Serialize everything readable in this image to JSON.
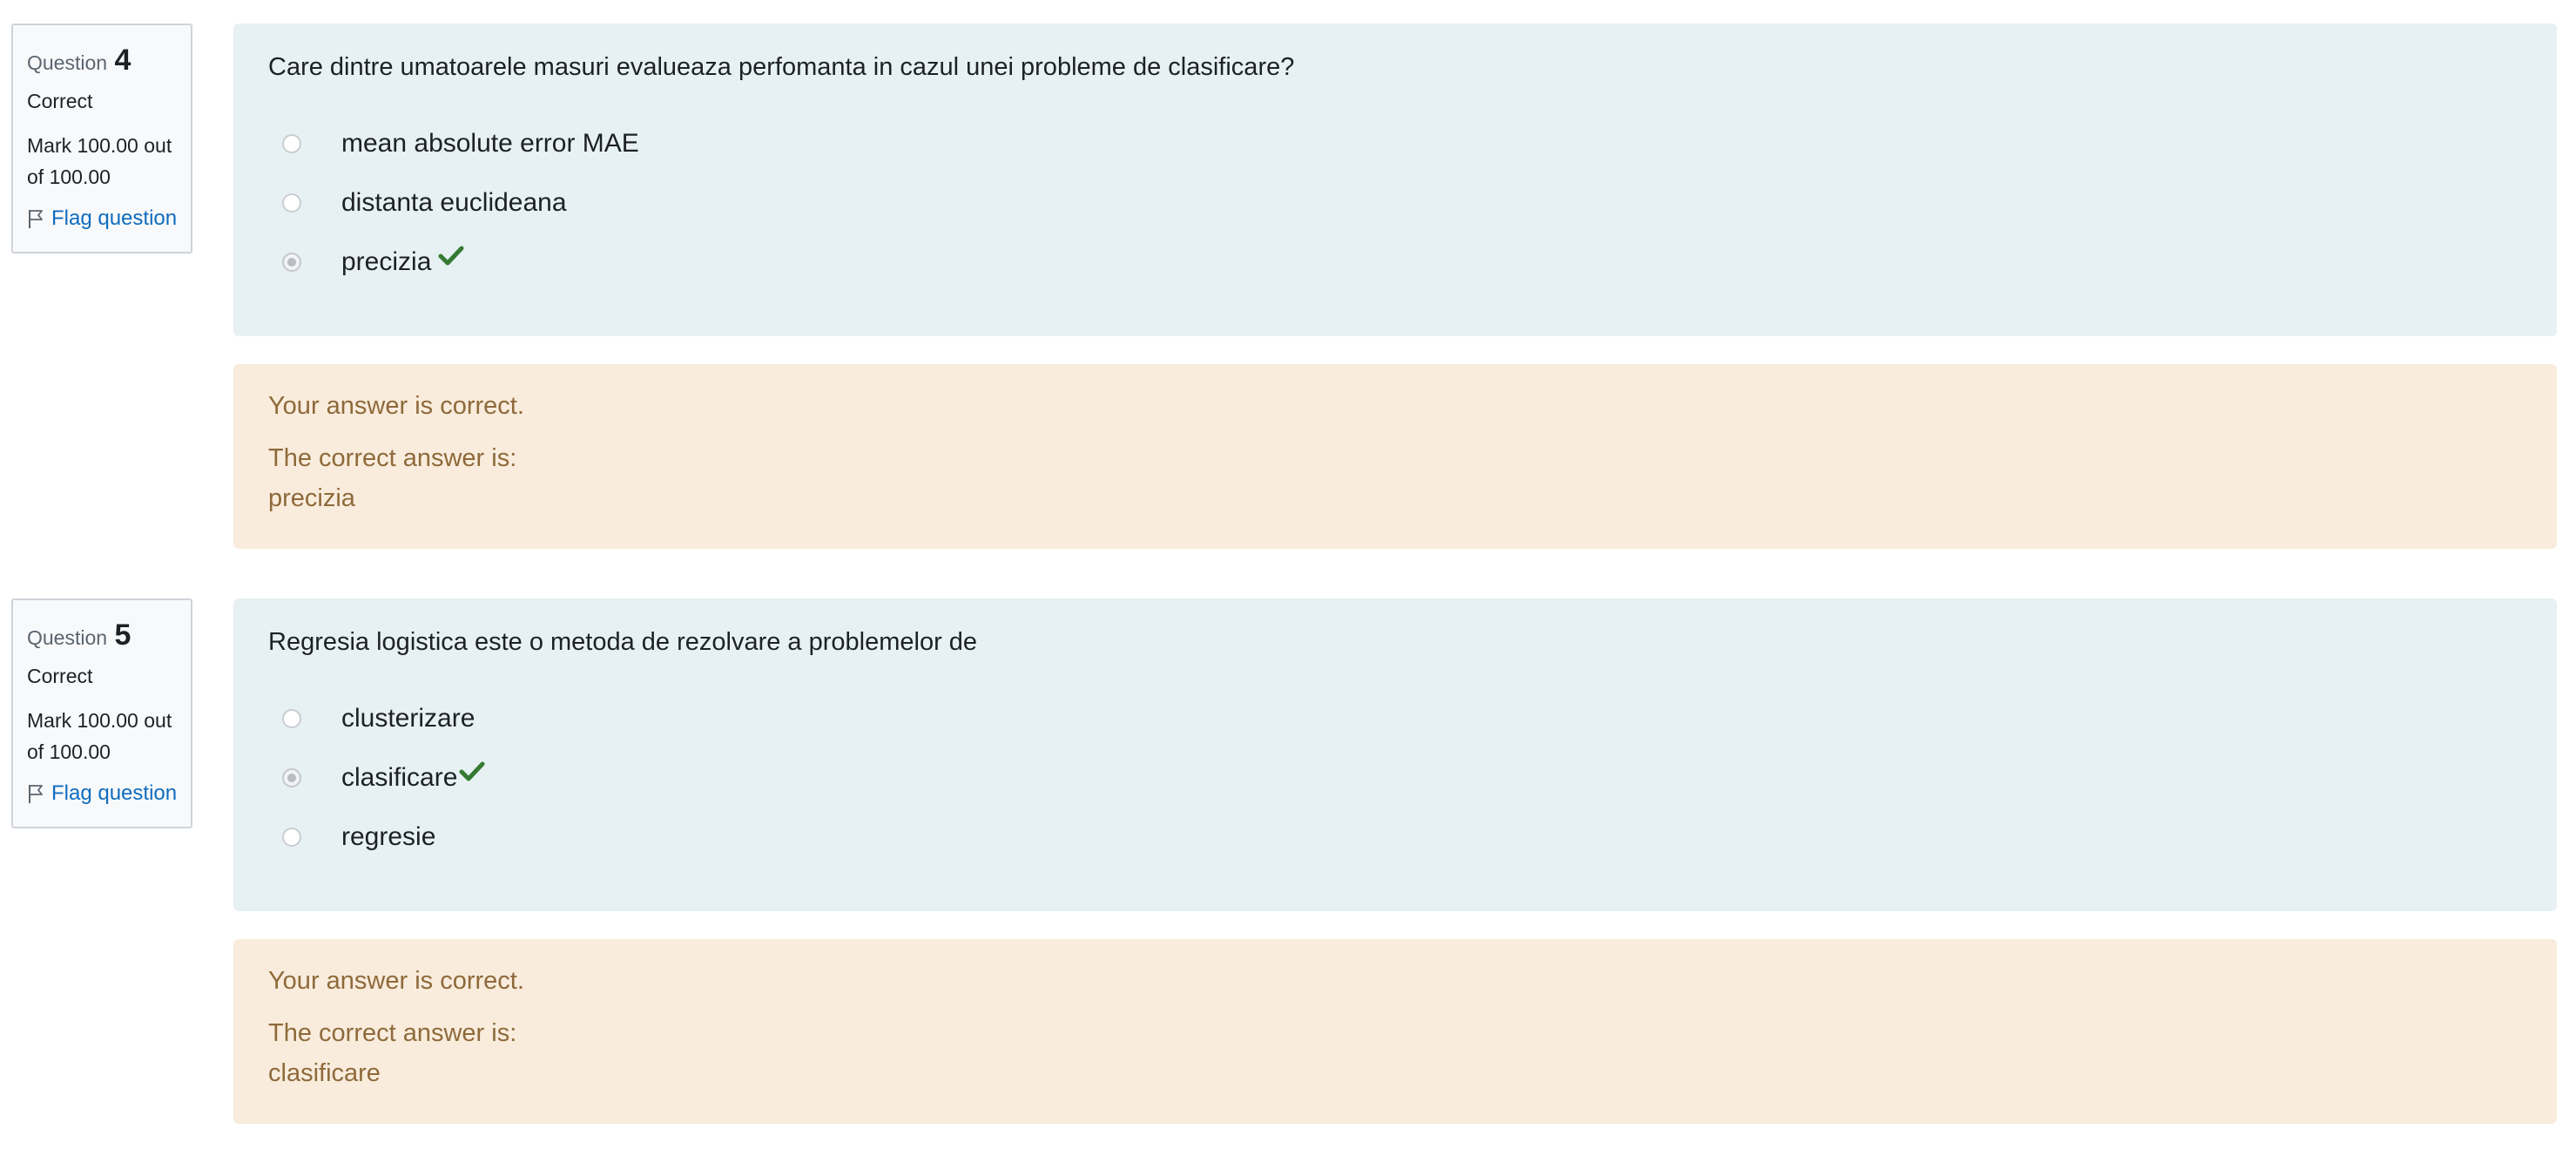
{
  "questions": [
    {
      "label": "Question",
      "number": "4",
      "state": "Correct",
      "grade": "Mark 100.00 out of 100.00",
      "flag_label": "Flag question",
      "text": "Care dintre umatoarele masuri evalueaza perfomanta in cazul unei probleme de clasificare?",
      "answers": [
        {
          "label": "mean absolute error MAE",
          "selected": false,
          "correct": false
        },
        {
          "label": "distanta euclideana",
          "selected": false,
          "correct": false
        },
        {
          "label": "precizia",
          "selected": true,
          "correct": true
        }
      ],
      "feedback": {
        "status": "Your answer is correct.",
        "right_answer_label": "The correct answer is:",
        "right_answer_value": "precizia"
      }
    },
    {
      "label": "Question",
      "number": "5",
      "state": "Correct",
      "grade": "Mark 100.00 out of 100.00",
      "flag_label": "Flag question",
      "text": "Regresia logistica este o metoda de rezolvare a problemelor de",
      "answers": [
        {
          "label": "clusterizare",
          "selected": false,
          "correct": false
        },
        {
          "label": "clasificare",
          "selected": true,
          "correct": true
        },
        {
          "label": "regresie",
          "selected": false,
          "correct": false
        }
      ],
      "feedback": {
        "status": "Your answer is correct.",
        "right_answer_label": "The correct answer is:",
        "right_answer_value": "clasificare"
      }
    }
  ],
  "colors": {
    "formulation_bg": "#e7f1f4",
    "feedback_bg": "#f9ecdd",
    "feedback_text": "#8e6a3a",
    "link": "#0f6cbf",
    "correct_check": "#357a32"
  },
  "icons": {
    "flag": "flag-icon",
    "correct": "checkmark-icon"
  }
}
